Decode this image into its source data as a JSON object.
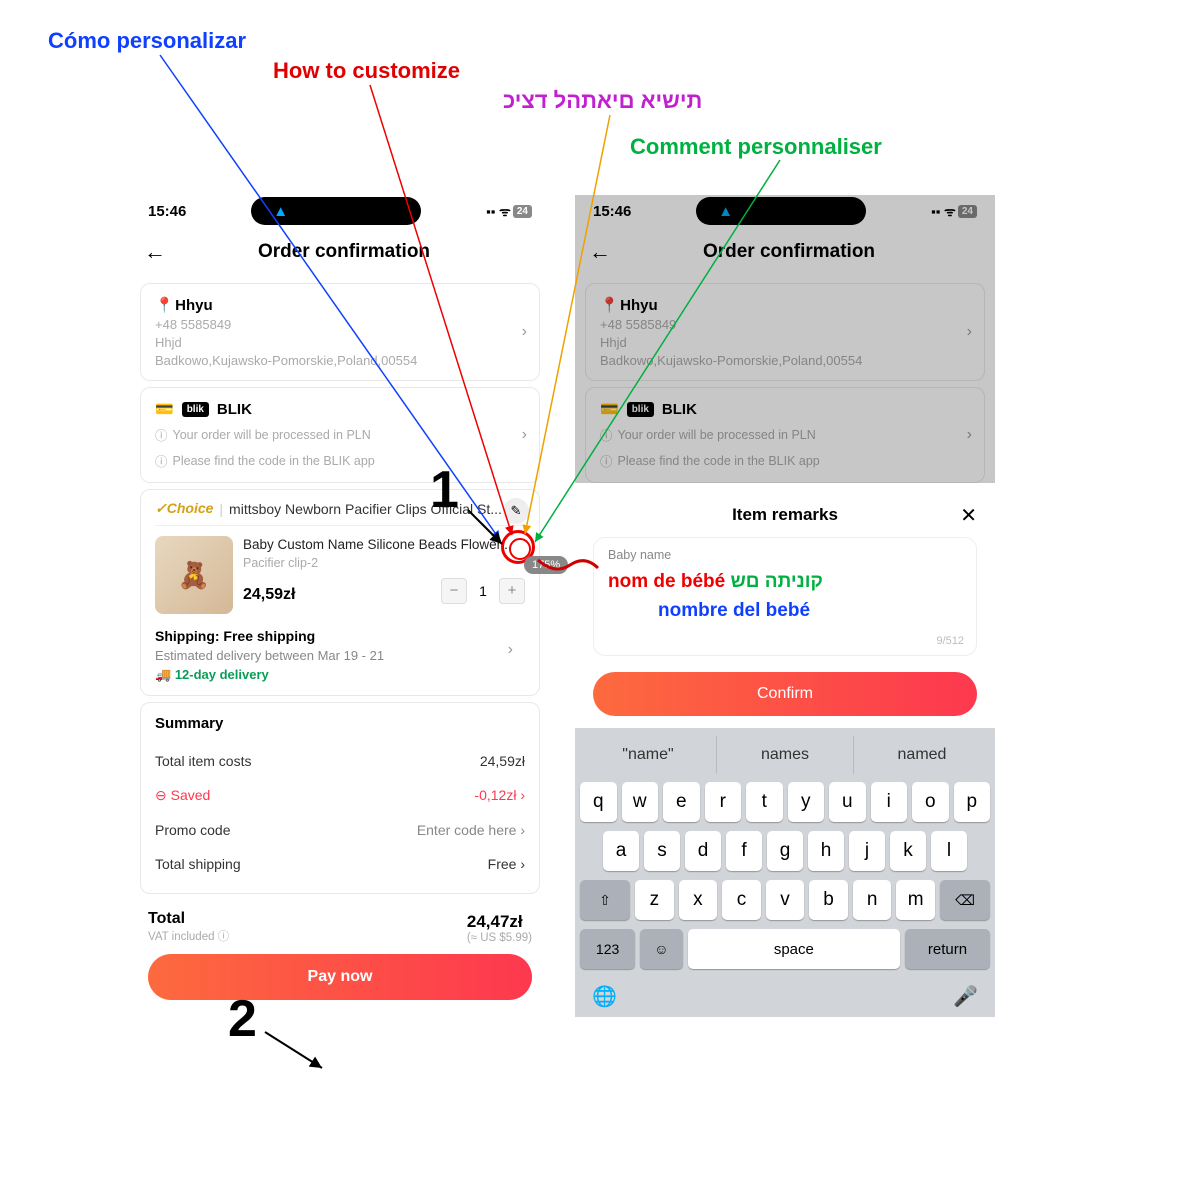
{
  "annotations": {
    "es": "Cómo personalizar",
    "en": "How to customize",
    "he": "תישיא םיאתהל דציכ",
    "fr": "Comment personnaliser"
  },
  "status": {
    "time": "15:46",
    "battery": "24"
  },
  "header": {
    "title": "Order confirmation"
  },
  "address": {
    "name": "Hhyu",
    "phone": "+48 5585849",
    "line1": "Hhjd",
    "line2": "Badkowo,Kujawsko-Pomorskie,Poland,00554"
  },
  "payment": {
    "method": "BLIK",
    "note1": "Your order will be processed in PLN",
    "note2": "Please find the code in the BLIK app"
  },
  "store": {
    "choice": "✓Choice",
    "name": "mittsboy Newborn Pacifier Clips Official St..."
  },
  "product": {
    "title": "Baby Custom Name Silicone Beads Flower...",
    "variant": "Pacifier clip-2",
    "price": "24,59zł",
    "qty": "1"
  },
  "shipping": {
    "label": "Shipping: Free shipping",
    "eta": "Estimated delivery between Mar 19 - 21",
    "badge": "12-day delivery"
  },
  "summary": {
    "title": "Summary",
    "items_label": "Total item costs",
    "items_value": "24,59zł",
    "saved_label": "Saved",
    "saved_value": "-0,12zł",
    "promo_label": "Promo code",
    "promo_value": "Enter code here",
    "ship_label": "Total shipping",
    "ship_value": "Free"
  },
  "total": {
    "label": "Total",
    "value": "24,47zł",
    "vat": "VAT included",
    "usd": "(≈ US $5.99)",
    "pay": "Pay now"
  },
  "modal": {
    "title": "Item remarks",
    "field_label": "Baby name",
    "hint_fr": "nom de bébé",
    "hint_he": "קוניתה םש",
    "hint_es": "nombre del bebé",
    "counter": "9/512",
    "confirm": "Confirm"
  },
  "keyboard": {
    "suggest": [
      "\"name\"",
      "names",
      "named"
    ],
    "row1": [
      "q",
      "w",
      "e",
      "r",
      "t",
      "y",
      "u",
      "i",
      "o",
      "p"
    ],
    "row2": [
      "a",
      "s",
      "d",
      "f",
      "g",
      "h",
      "j",
      "k",
      "l"
    ],
    "row3": [
      "z",
      "x",
      "c",
      "v",
      "b",
      "n",
      "m"
    ],
    "shift": "⇧",
    "backspace": "⌫",
    "num": "123",
    "emoji": "☺",
    "space": "space",
    "return": "return",
    "globe": "🌐",
    "mic": "🎤"
  },
  "zoom": "175%"
}
